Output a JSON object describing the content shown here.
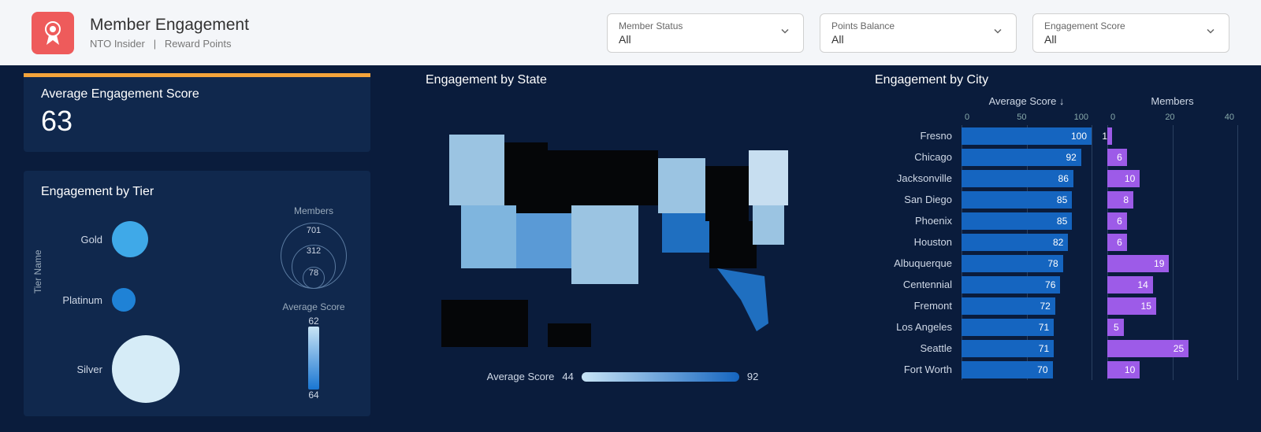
{
  "header": {
    "title": "Member Engagement",
    "breadcrumb_a": "NTO Insider",
    "breadcrumb_sep": "|",
    "breadcrumb_b": "Reward Points",
    "filters": [
      {
        "label": "Member Status",
        "value": "All"
      },
      {
        "label": "Points Balance",
        "value": "All"
      },
      {
        "label": "Engagement Score",
        "value": "All"
      }
    ]
  },
  "avg_card": {
    "label": "Average Engagement Score",
    "value": "63"
  },
  "tier_card": {
    "title": "Engagement by Tier",
    "y_axis": "Tier Name",
    "members_label": "Members",
    "avg_score_label": "Average Score",
    "legend_nums": [
      "701",
      "312",
      "78"
    ],
    "gradient_top": "62",
    "gradient_bottom": "64"
  },
  "state": {
    "title": "Engagement by State",
    "legend_label": "Average Score",
    "legend_min": "44",
    "legend_max": "92"
  },
  "city": {
    "title": "Engagement by City",
    "score_header": "Average Score ↓",
    "members_header": "Members",
    "score_ticks": [
      "0",
      "50",
      "100"
    ],
    "members_ticks": [
      "0",
      "20",
      "40"
    ]
  },
  "chart_data": {
    "avg_engagement_score": 63,
    "engagement_by_tier": {
      "type": "bubble",
      "y_axis": "Tier Name",
      "size_field": "Members",
      "color_field": "Average Score",
      "color_scale": [
        62,
        64
      ],
      "size_legend": [
        78,
        312,
        701
      ],
      "tiers": [
        {
          "name": "Gold",
          "members_approx": 312,
          "avg_score_approx": 63,
          "color": "#3fa9e8",
          "size": 46
        },
        {
          "name": "Platinum",
          "members_approx": 78,
          "avg_score_approx": 64,
          "color": "#1f82d6",
          "size": 30
        },
        {
          "name": "Silver",
          "members_approx": 701,
          "avg_score_approx": 62,
          "color": "#d6ecf7",
          "size": 86
        }
      ]
    },
    "engagement_by_state": {
      "type": "choropleth",
      "region": "US States",
      "color_field": "Average Score",
      "scale": [
        44,
        92
      ],
      "note": "Darker blue = higher average score; black/very dark = no data or low"
    },
    "engagement_by_city": {
      "type": "bar",
      "sort": "Average Score desc",
      "score_axis": [
        0,
        100
      ],
      "members_axis": [
        0,
        40
      ],
      "rows": [
        {
          "city": "Fresno",
          "avg_score": 100,
          "members": 1
        },
        {
          "city": "Chicago",
          "avg_score": 92,
          "members": 6
        },
        {
          "city": "Jacksonville",
          "avg_score": 86,
          "members": 10
        },
        {
          "city": "San Diego",
          "avg_score": 85,
          "members": 8
        },
        {
          "city": "Phoenix",
          "avg_score": 85,
          "members": 6
        },
        {
          "city": "Houston",
          "avg_score": 82,
          "members": 6
        },
        {
          "city": "Albuquerque",
          "avg_score": 78,
          "members": 19
        },
        {
          "city": "Centennial",
          "avg_score": 76,
          "members": 14
        },
        {
          "city": "Fremont",
          "avg_score": 72,
          "members": 15
        },
        {
          "city": "Los Angeles",
          "avg_score": 71,
          "members": 5
        },
        {
          "city": "Seattle",
          "avg_score": 71,
          "members": 25
        },
        {
          "city": "Fort Worth",
          "avg_score": 70,
          "members": 10
        }
      ]
    }
  }
}
